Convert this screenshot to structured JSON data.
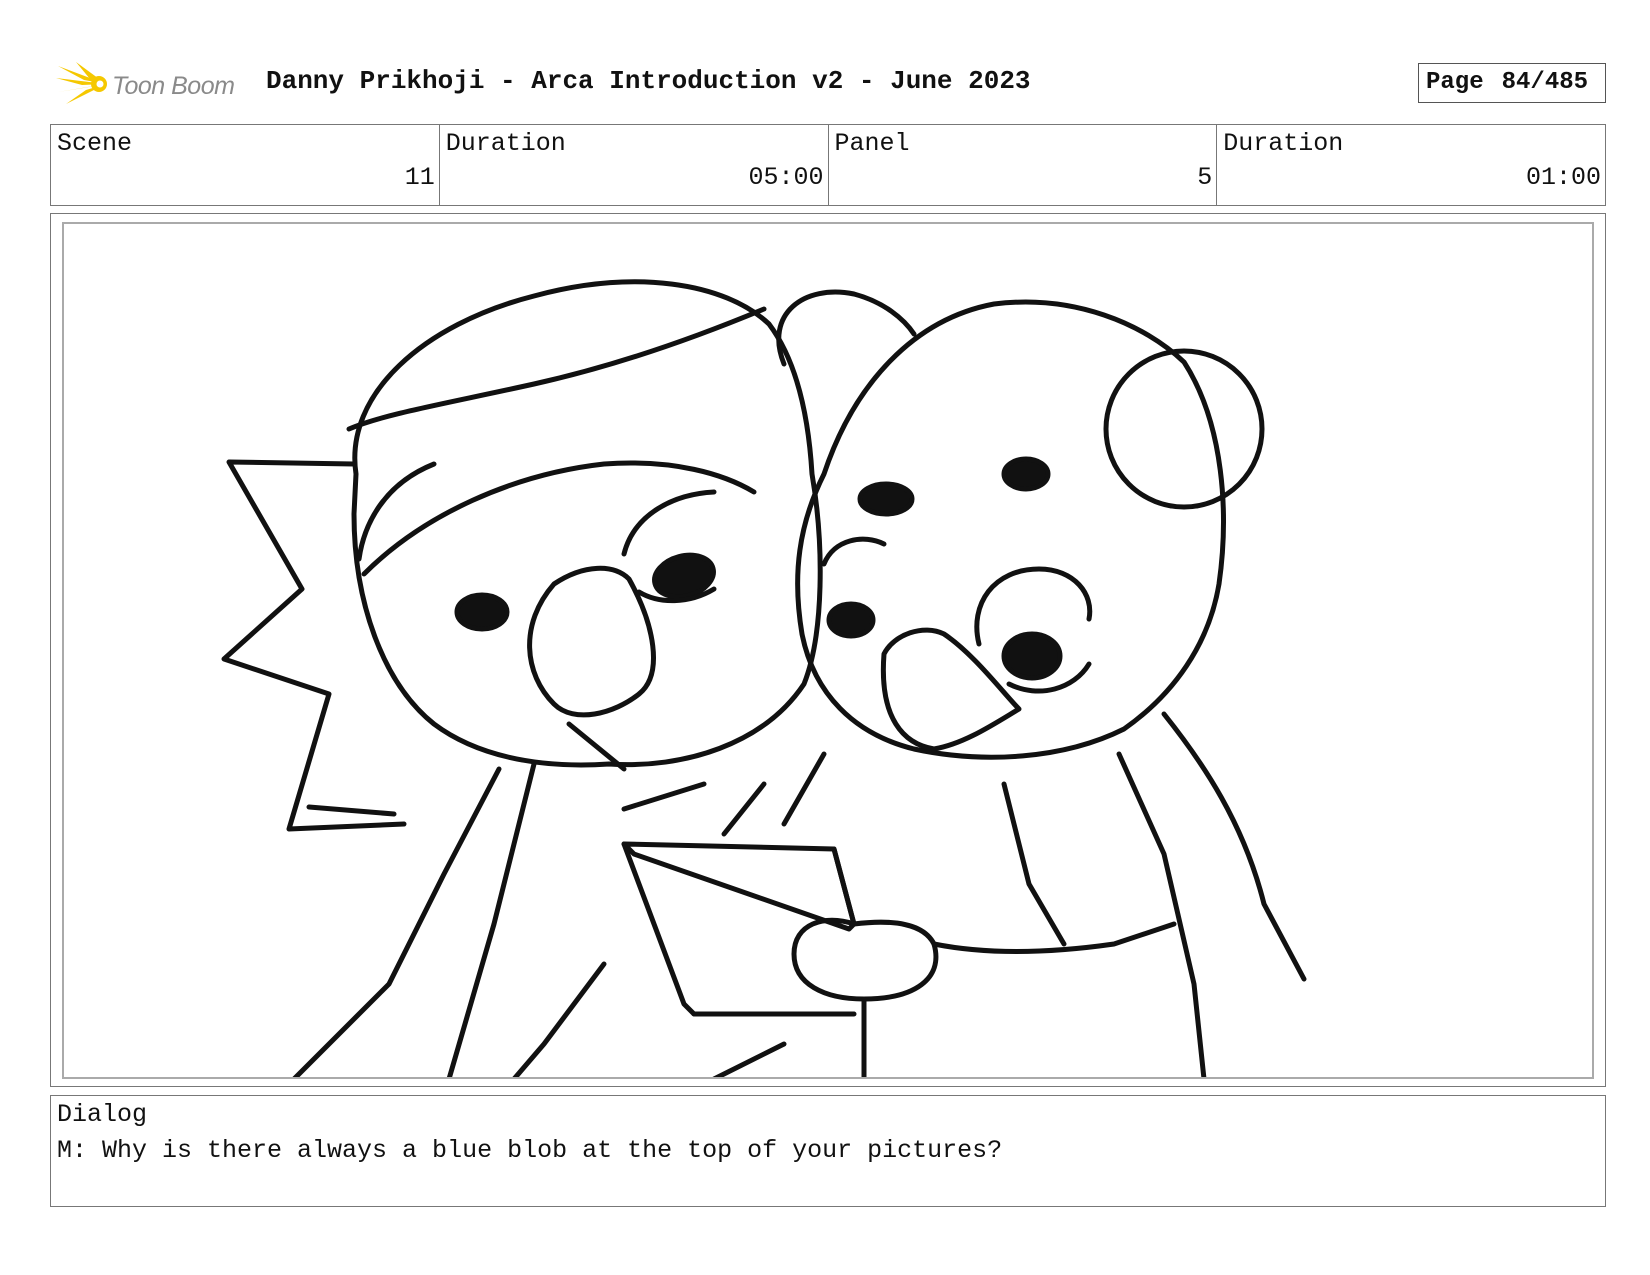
{
  "header": {
    "logo_text": "Toon Boom",
    "title": "Danny Prikhoji - Arca Introduction v2 - June 2023",
    "page_label": "Page",
    "page_number": "84/485"
  },
  "info": {
    "scene_label": "Scene",
    "scene_value": "11",
    "scene_duration_label": "Duration",
    "scene_duration_value": "05:00",
    "panel_label": "Panel",
    "panel_value": "5",
    "panel_duration_label": "Duration",
    "panel_duration_value": "01:00"
  },
  "dialog": {
    "label": "Dialog",
    "text": "M: Why is there always a blue blob at the top of your pictures?"
  },
  "colors": {
    "logo_burst": "#f5c800",
    "logo_text": "#8a8a8a",
    "border": "#777777",
    "ink": "#111111"
  }
}
